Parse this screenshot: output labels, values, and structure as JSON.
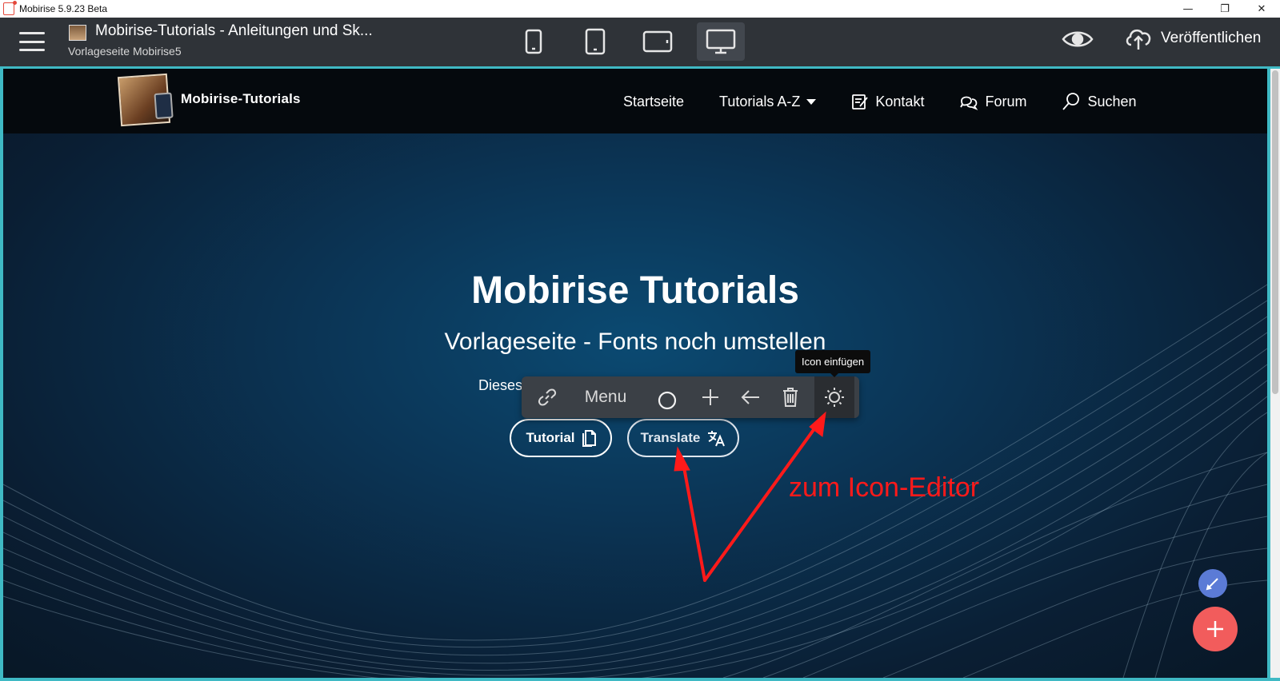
{
  "window": {
    "title": "Mobirise 5.9.23 Beta",
    "minimize": "—",
    "restore": "❐",
    "close": "✕"
  },
  "toolbar": {
    "project_title": "Mobirise-Tutorials - Anleitungen und Sk...",
    "project_subtitle": "Vorlageseite Mobirise5",
    "devices": [
      "phone",
      "tablet-portrait",
      "tablet-landscape",
      "desktop"
    ],
    "active_device": "desktop",
    "publish_label": "Veröffentlichen"
  },
  "site": {
    "brand": "Mobirise-Tutorials",
    "nav": [
      {
        "label": "Startseite",
        "icon": ""
      },
      {
        "label": "Tutorials A-Z",
        "icon": "caret-down"
      },
      {
        "label": "Kontakt",
        "icon": "edit-icon"
      },
      {
        "label": "Forum",
        "icon": "chat-icon"
      },
      {
        "label": "Suchen",
        "icon": "search-icon"
      }
    ],
    "hero_title": "Mobirise Tutorials",
    "hero_subtitle": "Vorlageseite - Fonts noch umstellen",
    "hero_text": "Dieses",
    "buttons": [
      {
        "label": "Tutorial",
        "icon": "document-icon"
      },
      {
        "label": "Translate",
        "icon": "translate-icon"
      }
    ]
  },
  "block_toolbar": {
    "items": [
      "link-icon",
      "Menu",
      "circle-icon",
      "plus-icon",
      "arrow-left-icon",
      "trash-icon",
      "sun-icon"
    ],
    "menu_label": "Menu",
    "tooltip": "Icon einfügen"
  },
  "annotation": {
    "text": "zum Icon-Editor",
    "color": "#ff1a1a"
  },
  "colors": {
    "accent_border": "#3fb9c4",
    "fab_add": "#f25c5c",
    "fab_edit": "#5b7bd6"
  }
}
